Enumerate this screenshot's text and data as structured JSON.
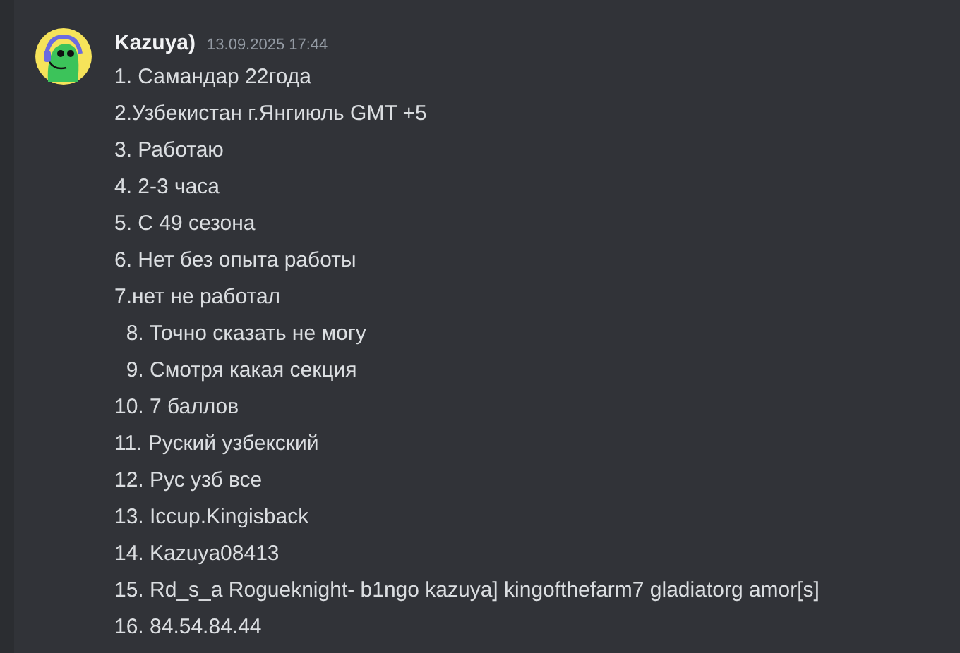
{
  "message": {
    "author": "Kazuya)",
    "timestamp": "13.09.2025 17:44",
    "lines": [
      "1. Самандар 22года",
      "2.Узбекистан г.Янгиюль GMT +5",
      "3. Работаю",
      "4. 2-3 часа",
      "5. С 49 сезона",
      "6. Нет без опыта работы",
      "7.нет не работал",
      "  8. Точно сказать не могу",
      "  9. Смотря какая секция",
      "10. 7 баллов",
      "11. Руский узбекский",
      "12. Рус узб все",
      "13. Iccup.Kingisback",
      "14. Kazuya08413",
      "15. Rd_s_a Rogueknight- b1ngo kazuya] kingofthefarm7 gladiatorg amor[s]",
      "16. 84.54.84.44"
    ]
  }
}
